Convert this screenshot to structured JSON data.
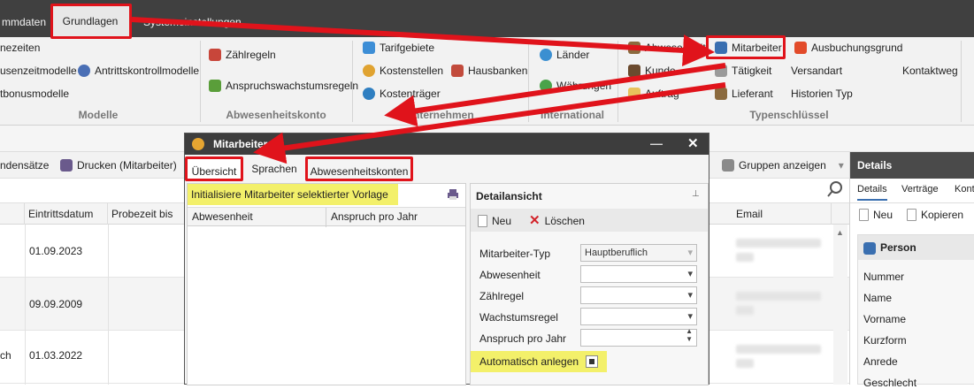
{
  "titlebar": {
    "tab_partial": "mmdaten",
    "tab_grundlagen": "Grundlagen",
    "tab_system": "Systemeinstellungen"
  },
  "ribbon": {
    "modelle": {
      "items": [
        "nezeiten",
        "usenzeitmodelle",
        "tbonusmodelle"
      ],
      "extra": "Antrittskontrollmodelle",
      "label": "Modelle"
    },
    "abwesenheit": {
      "items": [
        "Zählregeln",
        "Anspruchswachstumsregeln"
      ],
      "label": "Abwesenheitskonto"
    },
    "unternehmen": {
      "items": [
        "Tarifgebiete",
        "Kostenstellen",
        "Kostenträger"
      ],
      "extra": "Hausbanken",
      "label": "Unternehmen"
    },
    "international": {
      "items": [
        "Länder",
        "Währungen"
      ],
      "label": "International"
    },
    "typen": {
      "col1": [
        "Abwesenheit",
        "Kunde",
        "Auftrag"
      ],
      "col2": [
        "Mitarbeiter",
        "Tätigkeit",
        "Lieferant"
      ],
      "col3": [
        "Ausbuchungsgrund",
        "Versandart",
        "Historien Typ"
      ],
      "col4": "Kontaktweg",
      "label": "Typenschlüssel"
    }
  },
  "toolbar": {
    "left": "ndensätze",
    "print": "Drucken (Mitarbeiter)",
    "groups": "Gruppen anzeigen"
  },
  "grid": {
    "headers": [
      "Eintrittsdatum",
      "Probezeit bis",
      "Email"
    ],
    "rows": [
      {
        "prefix": "",
        "date": "01.09.2023"
      },
      {
        "prefix": "",
        "date": "09.09.2009"
      },
      {
        "prefix": "ch",
        "date": "01.03.2022"
      }
    ]
  },
  "details": {
    "title": "Details",
    "tabs": [
      "Details",
      "Verträge",
      "Kont"
    ],
    "new": "Neu",
    "copy": "Kopieren",
    "section": "Person",
    "fields": [
      "Nummer",
      "Name",
      "Vorname",
      "Kurzform",
      "Anrede",
      "Geschlecht"
    ]
  },
  "dialog": {
    "title": "Mitarbeiter",
    "tabs": [
      "Übersicht",
      "Sprachen",
      "Abwesenheitskonten"
    ],
    "init_text": "Initialisiere Mitarbeiter selektierter Vorlage",
    "columns": [
      "Abwesenheit",
      "Anspruch pro Jahr"
    ],
    "detail_title": "Detailansicht",
    "new": "Neu",
    "delete": "Löschen",
    "fields": [
      {
        "label": "Mitarbeiter-Typ",
        "value": "Hauptberuflich"
      },
      {
        "label": "Abwesenheit",
        "value": ""
      },
      {
        "label": "Zählregel",
        "value": ""
      },
      {
        "label": "Wachstumsregel",
        "value": ""
      },
      {
        "label": "Anspruch pro Jahr",
        "value": ""
      }
    ],
    "auto_label": "Automatisch anlegen"
  },
  "colors": {
    "highlight": "#e0131b",
    "yellow": "#f3f06a",
    "dark": "#3d3d3d"
  }
}
